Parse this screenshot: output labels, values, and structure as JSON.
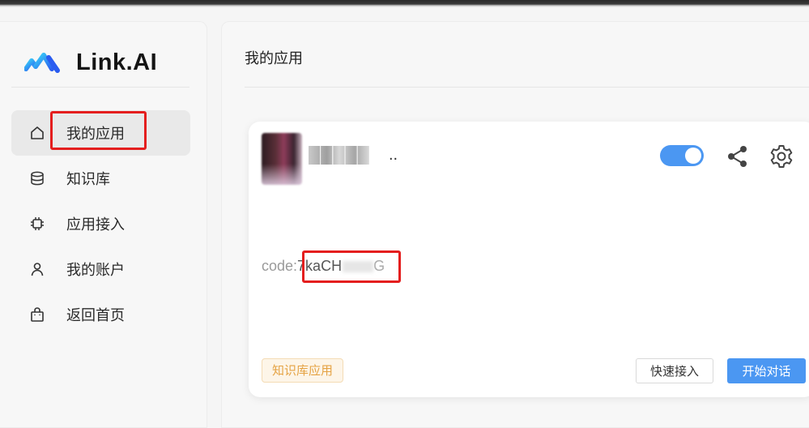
{
  "brand": {
    "name": "Link.AI",
    "accent": "#4b97f2",
    "highlight": "#e41e1e"
  },
  "sidebar": {
    "items": [
      {
        "label": "我的应用",
        "icon": "home-icon",
        "active": true
      },
      {
        "label": "知识库",
        "icon": "database-icon",
        "active": false
      },
      {
        "label": "应用接入",
        "icon": "chip-icon",
        "active": false
      },
      {
        "label": "我的账户",
        "icon": "user-icon",
        "active": false
      },
      {
        "label": "返回首页",
        "icon": "shopping-bag-icon",
        "active": false
      }
    ]
  },
  "main": {
    "title": "我的应用",
    "card": {
      "app_name_dots": "..",
      "enabled": true,
      "code_label": "code:",
      "code_value": "7kaCH",
      "code_tail": "G",
      "tag": "知识库应用",
      "quick_access_label": "快速接入",
      "start_chat_label": "开始对话"
    }
  }
}
